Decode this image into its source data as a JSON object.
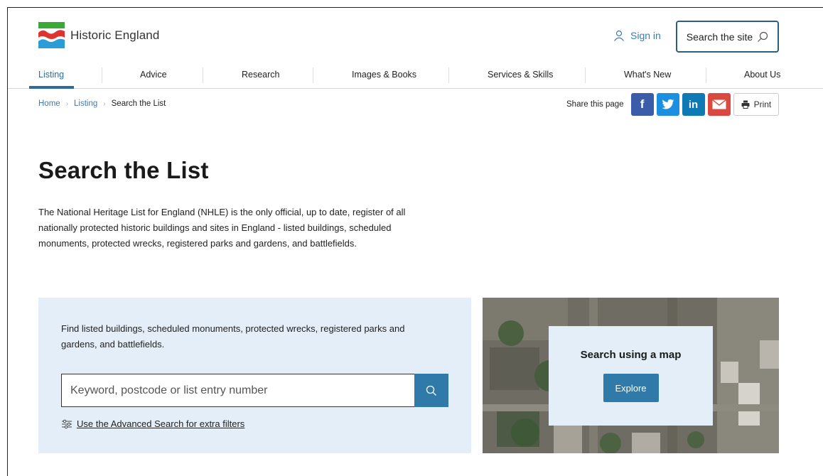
{
  "header": {
    "logo_text": "Historic England",
    "signin_label": "Sign in",
    "search_site_label": "Search the site"
  },
  "nav": {
    "items": [
      {
        "label": "Listing",
        "active": true
      },
      {
        "label": "Advice"
      },
      {
        "label": "Research"
      },
      {
        "label": "Images & Books"
      },
      {
        "label": "Services & Skills"
      },
      {
        "label": "What's New"
      },
      {
        "label": "About Us"
      }
    ]
  },
  "breadcrumb": {
    "home": "Home",
    "listing": "Listing",
    "current": "Search the List"
  },
  "share": {
    "label": "Share this page",
    "facebook_icon": "f",
    "linkedin_icon": "in",
    "print_label": "Print",
    "colors": {
      "facebook": "#3b5ca8",
      "twitter": "#1d8fe0",
      "linkedin": "#0d7ab5",
      "email": "#d9493f"
    }
  },
  "main": {
    "title": "Search the List",
    "intro": "The National Heritage List for England (NHLE) is the only official, up to date, register of all nationally protected historic buildings and sites in England - listed buildings, scheduled monuments, protected wrecks, registered parks and gardens, and battlefields."
  },
  "search_panel": {
    "description": "Find listed buildings, scheduled monuments, protected wrecks, registered parks and gardens, and battlefields.",
    "input_placeholder": "Keyword, postcode or list entry number",
    "advanced_link": "Use the Advanced Search for extra filters"
  },
  "map_panel": {
    "title": "Search using a map",
    "button_label": "Explore"
  },
  "colors": {
    "accent": "#2f7aa8",
    "link": "#3a7bb3",
    "panel_bg": "#e3eef9"
  }
}
